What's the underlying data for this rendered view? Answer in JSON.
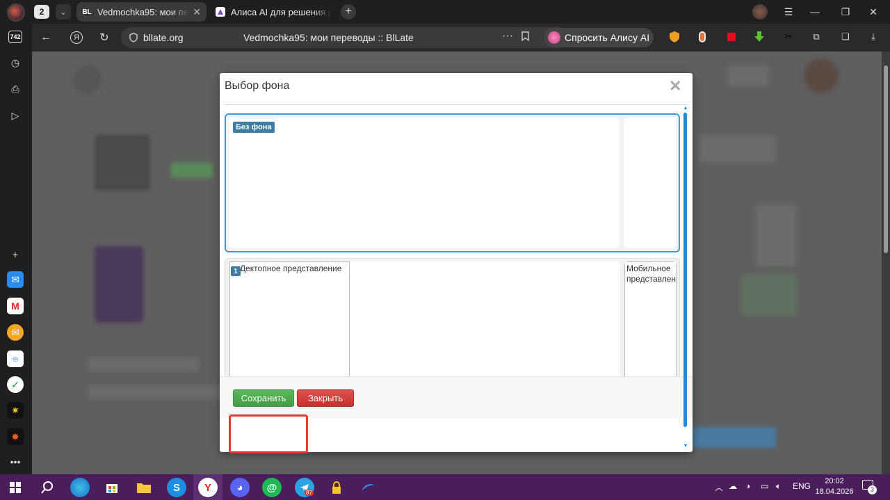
{
  "browser": {
    "tab_count": "2",
    "tabs": [
      {
        "label": "Vedmochka95: мои переводы :: BlLate",
        "favicon": "BL"
      },
      {
        "label": "Алиса AI для решения ре",
        "favicon": "A"
      }
    ],
    "url_domain": "bllate.org",
    "page_title": "Vedmochka95: мои переводы :: BlLate",
    "alice_button": "Спросить Алису AI",
    "sidebar_counter": "742"
  },
  "modal": {
    "title": "Выбор фона",
    "options": [
      {
        "badge": "Без фона"
      },
      {
        "desktop_alt": "Дектопное представление",
        "mobile_alt": "Мобильное представление",
        "number": "1"
      }
    ],
    "save_label": "Сохранить",
    "close_label": "Закрыть"
  },
  "taskbar": {
    "telegram_badge": "87",
    "lang": "ENG",
    "time": "20:02",
    "date": "18.04.2026",
    "notifications": "3"
  },
  "colors": {
    "accent_blue": "#3a9ad9",
    "save_green": "#5cb85c",
    "close_red": "#d9534f",
    "highlight_red": "#e53935",
    "taskbar_purple": "#4a1e5a"
  }
}
